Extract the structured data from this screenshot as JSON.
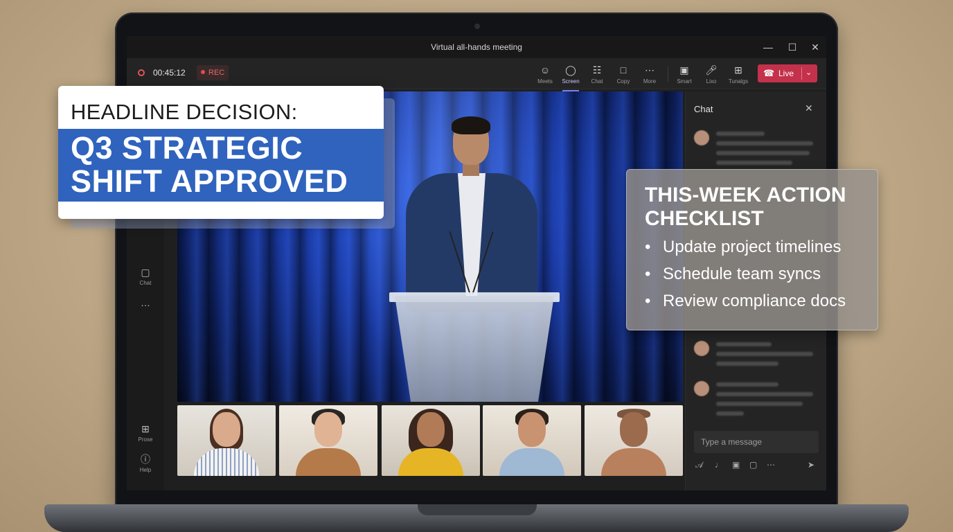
{
  "window": {
    "title": "Virtual all-hands meeting",
    "controls": [
      "—",
      "☐",
      "✕"
    ]
  },
  "toolbar": {
    "timer": "00:45:12",
    "rec_label": "REC",
    "tools": [
      {
        "label": "Meets",
        "icon": "people-icon"
      },
      {
        "label": "Screen",
        "icon": "chat-bubble-icon"
      },
      {
        "label": "Chat",
        "icon": "chat-icon"
      },
      {
        "label": "Copy",
        "icon": "clipboard-icon"
      },
      {
        "label": "More",
        "icon": "more-icon"
      },
      {
        "label": "Smart",
        "icon": "camera-off-icon"
      },
      {
        "label": "Lixo",
        "icon": "mic-icon"
      },
      {
        "label": "Tunalgs",
        "icon": "share-icon"
      }
    ],
    "live_label": "Live"
  },
  "rail": {
    "items": [
      {
        "label": "Chat"
      },
      {
        "label": "…"
      },
      {
        "label": "Prose"
      },
      {
        "label": "Help"
      }
    ]
  },
  "chat": {
    "title": "Chat",
    "placeholder": "Type a message"
  },
  "headline": {
    "kicker": "HEADLINE DECISION:",
    "main": "Q3 STRATEGIC SHIFT APPROVED"
  },
  "checklist": {
    "title": "THIS-WEEK ACTION CHECKLIST",
    "items": [
      "Update project timelines",
      "Schedule team syncs",
      "Review compliance docs"
    ]
  },
  "colors": {
    "accent": "#7b83eb",
    "live": "#c4314b",
    "headline_band": "#2f63bd"
  }
}
